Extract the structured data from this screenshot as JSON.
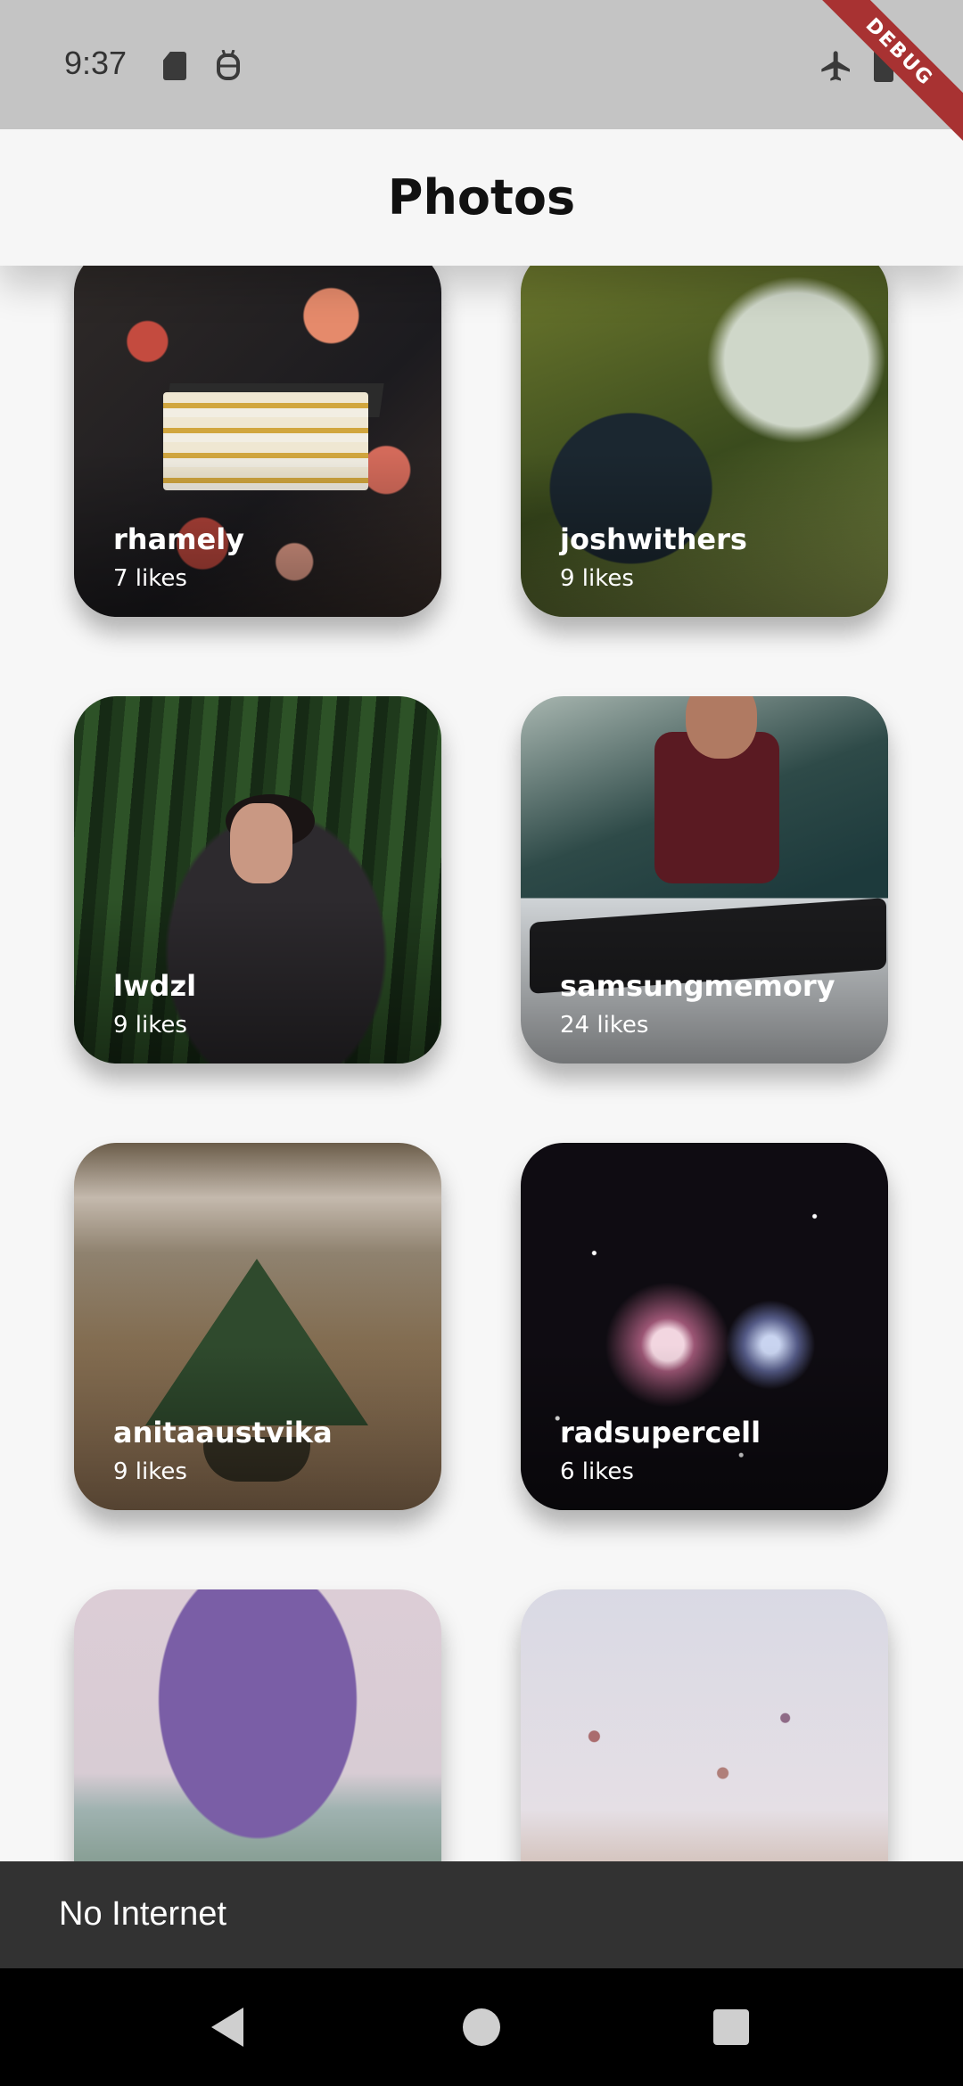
{
  "status_bar": {
    "time": "9:37",
    "icons": [
      "sd-card-icon",
      "android-debug-icon",
      "airplane-mode-icon",
      "battery-icon"
    ],
    "debug_label": "DEBUG"
  },
  "app_bar": {
    "title": "Photos"
  },
  "photos": [
    {
      "user": "rhamely",
      "likes": "7 likes"
    },
    {
      "user": "joshwithers",
      "likes": "9 likes"
    },
    {
      "user": "lwdzl",
      "likes": "9 likes"
    },
    {
      "user": "samsungmemory",
      "likes": "24 likes"
    },
    {
      "user": "anitaaustvika",
      "likes": "9 likes"
    },
    {
      "user": "radsupercell",
      "likes": "6 likes"
    }
  ],
  "snackbar": {
    "message": "No Internet"
  },
  "colors": {
    "status_bar": "#c4c4c4",
    "app_bar": "#f6f6f6",
    "snackbar": "#323232",
    "nav_bar": "#000000",
    "debug_ribbon": "#a83232"
  }
}
